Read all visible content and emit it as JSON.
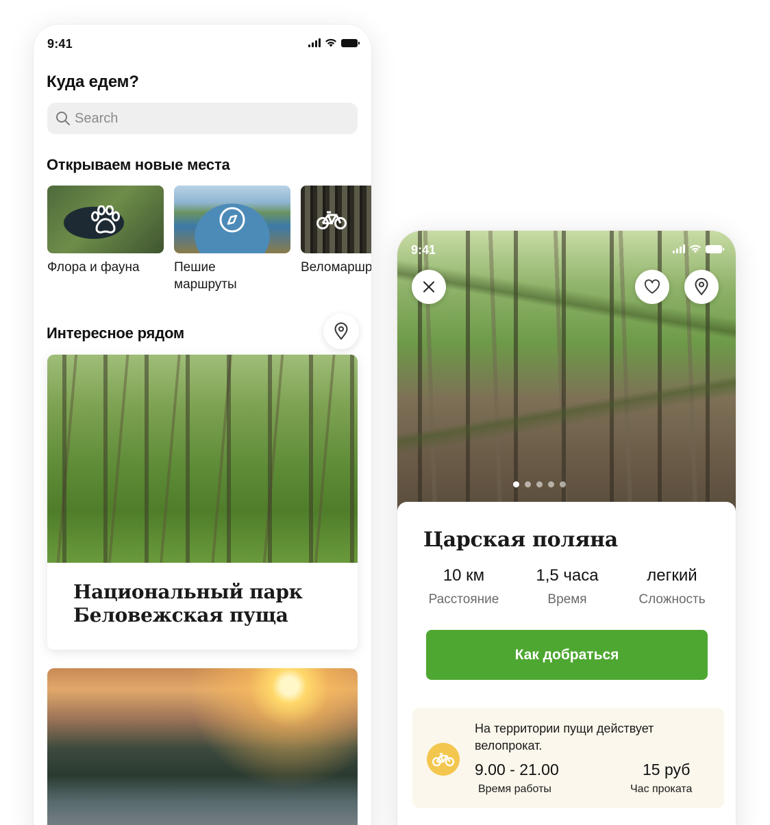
{
  "left_screen": {
    "status": {
      "time": "9:41"
    },
    "heading": "Куда едем?",
    "search": {
      "placeholder": "Search"
    },
    "discover": {
      "heading": "Открываем новые места",
      "categories": [
        {
          "label": "Флора и фауна",
          "icon": "paw-icon"
        },
        {
          "label": "Пешие\nмаршруты",
          "icon": "compass-icon"
        },
        {
          "label": "Веломаршруты",
          "icon": "bicycle-icon"
        }
      ]
    },
    "nearby": {
      "heading": "Интересное рядом",
      "cards": [
        {
          "title": "Национальный парк\nБеловежская пуща"
        }
      ]
    }
  },
  "right_screen": {
    "status": {
      "time": "9:41"
    },
    "gallery": {
      "dot_count": 5,
      "active_dot": 0
    },
    "title": "Царская поляна",
    "stats": [
      {
        "value": "10 км",
        "label": "Расстояние"
      },
      {
        "value": "1,5 часа",
        "label": "Время"
      },
      {
        "value": "легкий",
        "label": "Сложность"
      }
    ],
    "directions_button": "Как добраться",
    "rental": {
      "note": "На территории пущи действует велопрокат.",
      "hours_value": "9.00 - 21.00",
      "hours_label": "Время работы",
      "price_value": "15 руб",
      "price_label": "Час проката"
    }
  },
  "colors": {
    "accent_green": "#4ea731",
    "bike_badge": "#f3c74f",
    "rental_bg": "#fbf7ec",
    "search_bg": "#efefef"
  }
}
